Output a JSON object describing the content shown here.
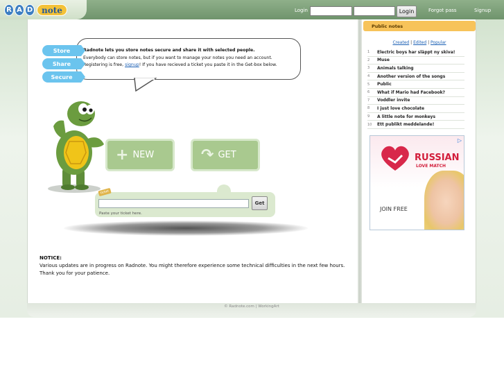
{
  "header": {
    "logo_letters": [
      "R",
      "A",
      "D"
    ],
    "logo_word": "note",
    "login_label": "Login",
    "login_button": "Login",
    "forgot_pass": "Forgot pass",
    "signup": "Signup"
  },
  "intro": {
    "pills": [
      "Store",
      "Share",
      "Secure"
    ],
    "line1": "Radnote lets you store notes secure and share it with selected people.",
    "line2": "Everybody can store notes, but if you want to manage your notes you need an account.",
    "line3_pre": "Registering is free, ",
    "line3_link": "signup",
    "line3_post": "! If you have recieved a ticket you paste it in the Get-box below."
  },
  "actions": {
    "new_label": "NEW",
    "get_label": "GET",
    "ticket_tag": "ticket",
    "ticket_get": "Get",
    "ticket_hint": "Paste your ticket here."
  },
  "notice": {
    "title": "NOTICE:",
    "line1": "Various updates are in progress on Radnote. You might therefore experience some technical difficulties in the next few hours.",
    "line2": "Thank you for your patience."
  },
  "sidebar": {
    "title": "Public notes",
    "links": [
      "Created",
      "Edited",
      "Popular"
    ],
    "notes": [
      {
        "n": "1",
        "title": "Electric boys har släppt ny skiva!"
      },
      {
        "n": "2",
        "title": "Muse"
      },
      {
        "n": "3",
        "title": "Animals talking"
      },
      {
        "n": "4",
        "title": "Another version of the songs"
      },
      {
        "n": "5",
        "title": "Public"
      },
      {
        "n": "6",
        "title": "What if Mario had Facebook?"
      },
      {
        "n": "7",
        "title": "Voddler invite"
      },
      {
        "n": "8",
        "title": "I just love chocolate"
      },
      {
        "n": "9",
        "title": "A little note for monkeys"
      },
      {
        "n": "10",
        "title": "Ett publikt meddelande!"
      }
    ]
  },
  "ad": {
    "brand1": "RUSSIAN",
    "brand2": "LOVE MATCH",
    "cta": "JOIN FREE"
  },
  "footer": {
    "text": "© Radnote.com | WorkingArt"
  }
}
